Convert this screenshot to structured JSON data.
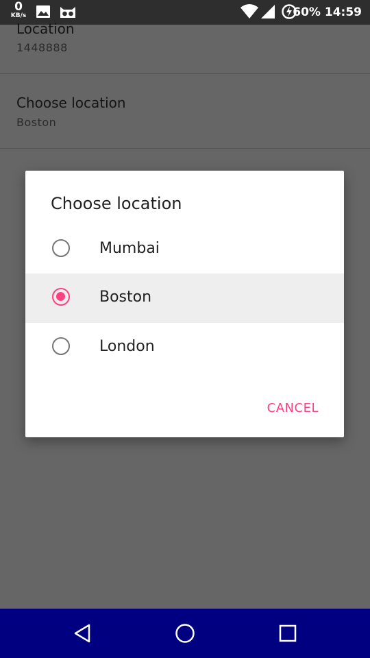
{
  "status_bar": {
    "speed_value": "0",
    "speed_unit": "KB/s",
    "battery_time": "60% 14:59",
    "icons": [
      "image-icon",
      "cat-face-icon",
      "wifi-icon",
      "signal-icon",
      "battery-icon"
    ]
  },
  "settings": {
    "items": [
      {
        "title": "Location",
        "summary": "1448888"
      },
      {
        "title": "Choose location",
        "summary": "Boston"
      }
    ]
  },
  "dialog": {
    "title": "Choose location",
    "options": [
      {
        "label": "Mumbai",
        "selected": false
      },
      {
        "label": "Boston",
        "selected": true
      },
      {
        "label": "London",
        "selected": false
      }
    ],
    "cancel_label": "CANCEL"
  },
  "colors": {
    "accent": "#ff4081",
    "scrim": "#666666",
    "nav_bar": "#000080"
  },
  "nav_bar": {
    "buttons": [
      "back-icon",
      "home-icon",
      "recents-icon"
    ]
  }
}
